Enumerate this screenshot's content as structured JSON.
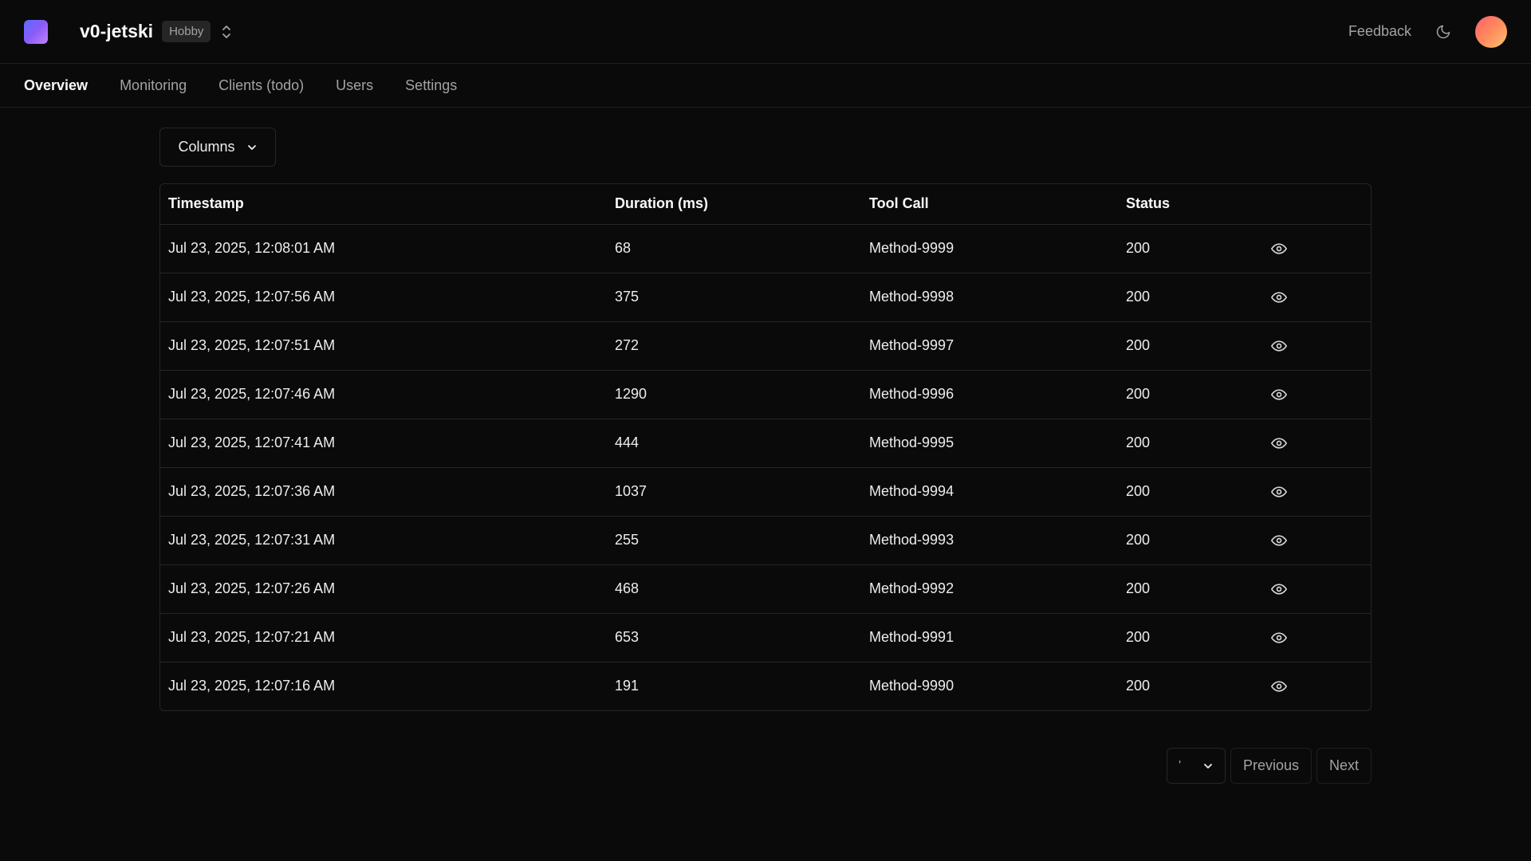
{
  "header": {
    "project_name": "v0-jetski",
    "plan": "Hobby",
    "feedback_label": "Feedback",
    "logo_icon": "app-logo",
    "theme_icon": "moon-icon",
    "switch_icon": "chevron-up-down-icon"
  },
  "tabs": [
    {
      "label": "Overview",
      "active": true
    },
    {
      "label": "Monitoring",
      "active": false
    },
    {
      "label": "Clients (todo)",
      "active": false
    },
    {
      "label": "Users",
      "active": false
    },
    {
      "label": "Settings",
      "active": false
    }
  ],
  "toolbar": {
    "columns_label": "Columns"
  },
  "table": {
    "headers": {
      "timestamp": "Timestamp",
      "duration": "Duration (ms)",
      "tool_call": "Tool Call",
      "status": "Status"
    },
    "rows": [
      {
        "timestamp": "Jul 23, 2025, 12:08:01 AM",
        "duration": "68",
        "tool_call": "Method-9999",
        "status": "200"
      },
      {
        "timestamp": "Jul 23, 2025, 12:07:56 AM",
        "duration": "375",
        "tool_call": "Method-9998",
        "status": "200"
      },
      {
        "timestamp": "Jul 23, 2025, 12:07:51 AM",
        "duration": "272",
        "tool_call": "Method-9997",
        "status": "200"
      },
      {
        "timestamp": "Jul 23, 2025, 12:07:46 AM",
        "duration": "1290",
        "tool_call": "Method-9996",
        "status": "200"
      },
      {
        "timestamp": "Jul 23, 2025, 12:07:41 AM",
        "duration": "444",
        "tool_call": "Method-9995",
        "status": "200"
      },
      {
        "timestamp": "Jul 23, 2025, 12:07:36 AM",
        "duration": "1037",
        "tool_call": "Method-9994",
        "status": "200"
      },
      {
        "timestamp": "Jul 23, 2025, 12:07:31 AM",
        "duration": "255",
        "tool_call": "Method-9993",
        "status": "200"
      },
      {
        "timestamp": "Jul 23, 2025, 12:07:26 AM",
        "duration": "468",
        "tool_call": "Method-9992",
        "status": "200"
      },
      {
        "timestamp": "Jul 23, 2025, 12:07:21 AM",
        "duration": "653",
        "tool_call": "Method-9991",
        "status": "200"
      },
      {
        "timestamp": "Jul 23, 2025, 12:07:16 AM",
        "duration": "191",
        "tool_call": "Method-9990",
        "status": "200"
      }
    ]
  },
  "pagination": {
    "page_value": "'",
    "previous_label": "Previous",
    "next_label": "Next"
  }
}
